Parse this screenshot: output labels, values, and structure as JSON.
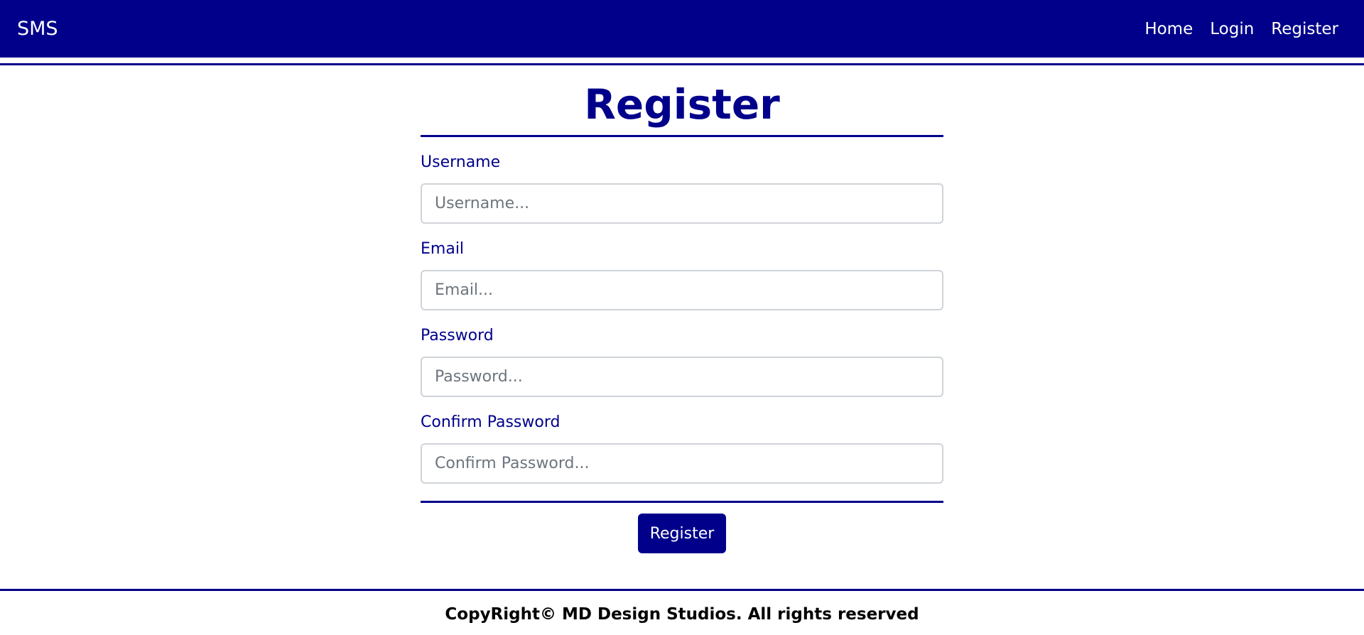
{
  "navbar": {
    "brand": "SMS",
    "links": [
      {
        "label": "Home"
      },
      {
        "label": "Login"
      },
      {
        "label": "Register"
      }
    ],
    "background": "#00008b"
  },
  "form": {
    "title": "Register",
    "fields": [
      {
        "label": "Username",
        "placeholder": "Username...",
        "value": ""
      },
      {
        "label": "Email",
        "placeholder": "Email...",
        "value": ""
      },
      {
        "label": "Password",
        "placeholder": "Password...",
        "value": ""
      },
      {
        "label": "Confirm Password",
        "placeholder": "Confirm Password...",
        "value": ""
      }
    ],
    "submit_label": "Register"
  },
  "footer": {
    "text": "CopyRight© MD Design Studios. All rights reserved"
  },
  "colors": {
    "accent": "#00008b",
    "input_border": "#cfd3d8",
    "placeholder": "#6c757d"
  }
}
